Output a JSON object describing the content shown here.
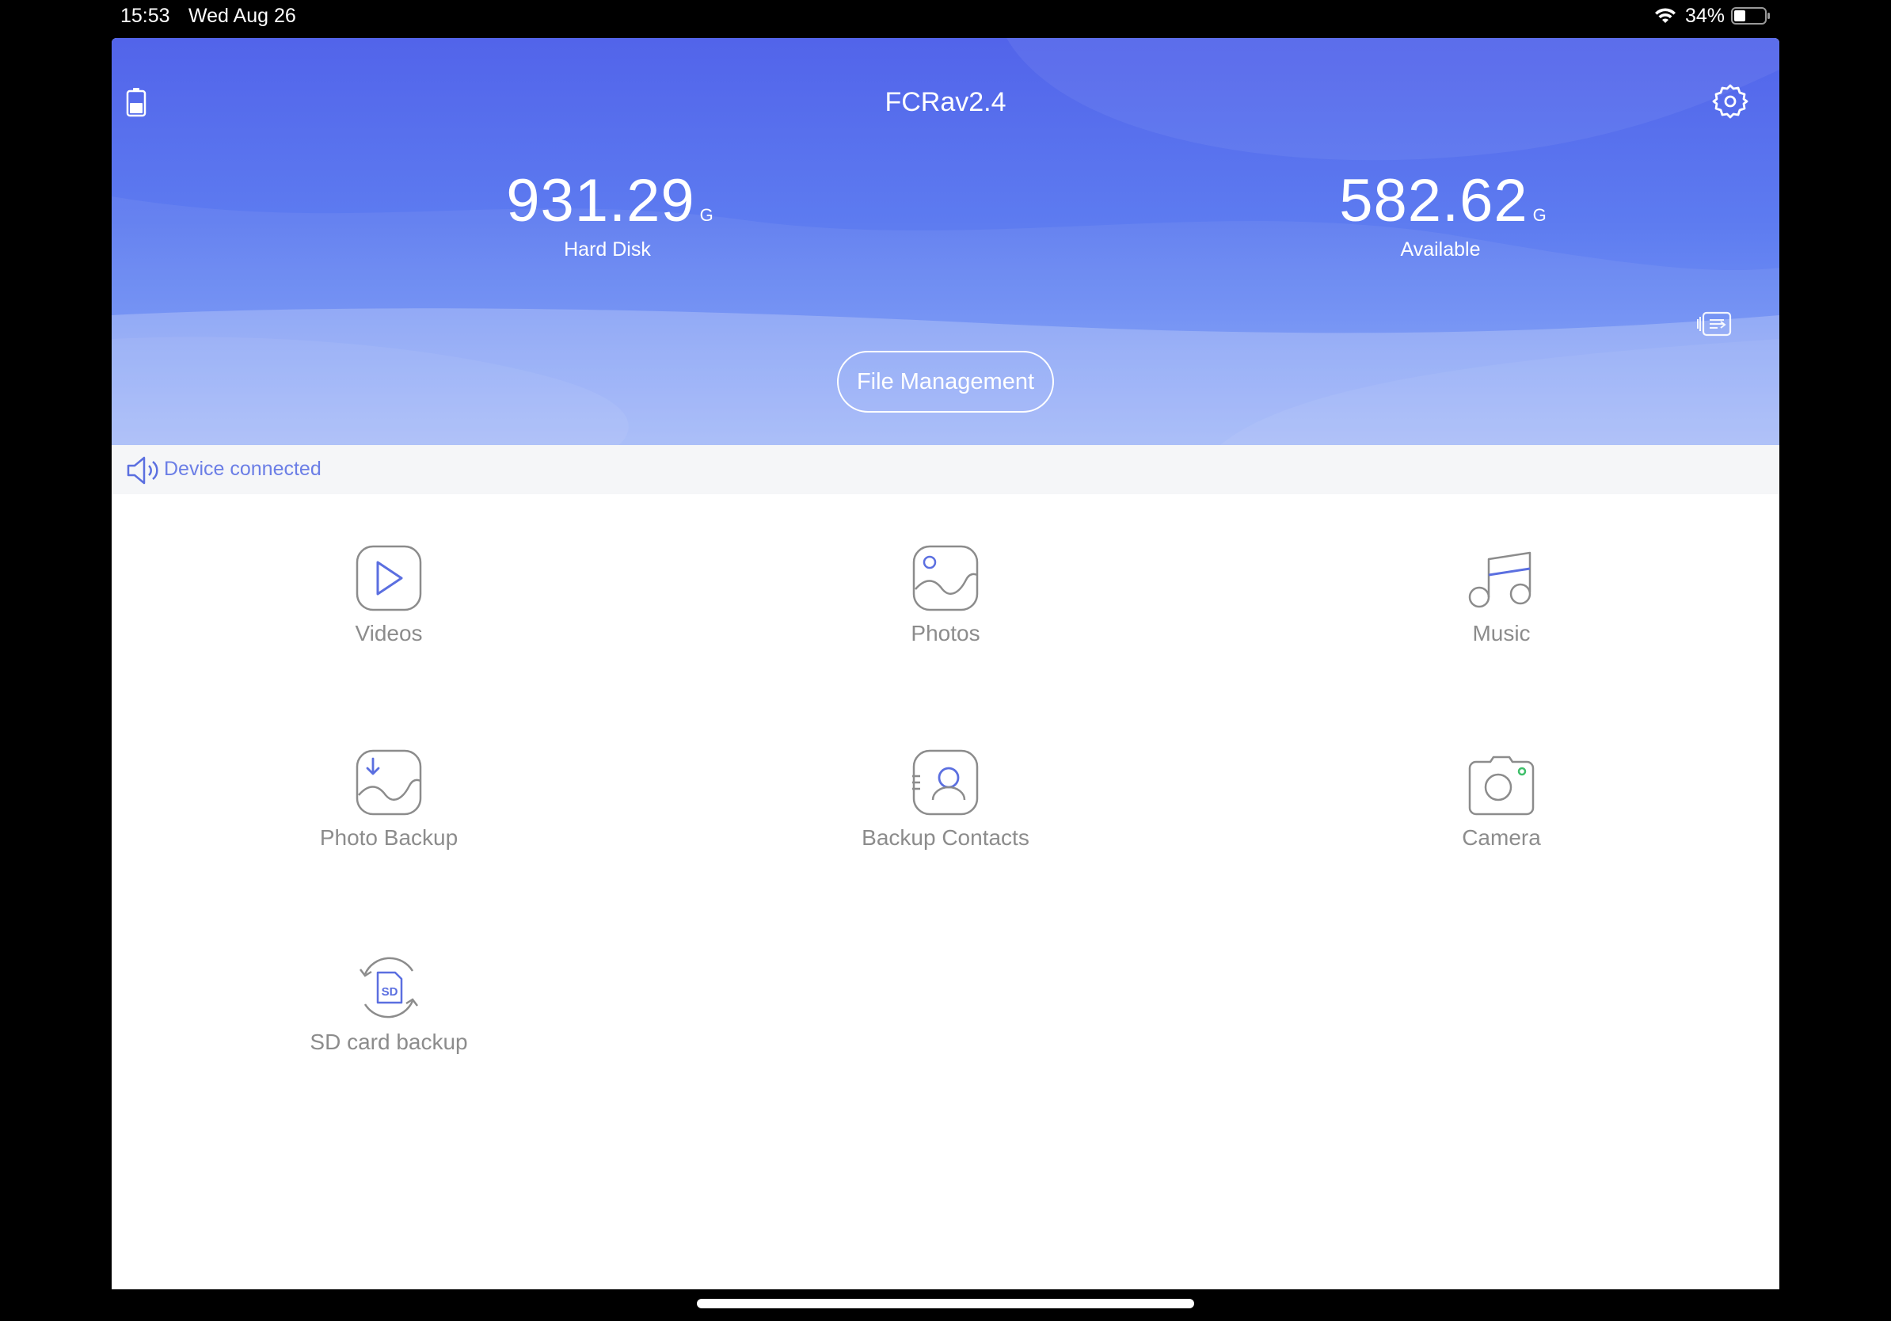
{
  "status_bar": {
    "time": "15:53",
    "date": "Wed Aug 26",
    "battery_percent": "34%",
    "icons": [
      "wifi-icon",
      "battery-icon"
    ]
  },
  "header": {
    "title": "FCRav2.4",
    "hard_disk": {
      "value": "931.29",
      "unit": "G",
      "label": "Hard Disk"
    },
    "available": {
      "value": "582.62",
      "unit": "G",
      "label": "Available"
    },
    "file_management_label": "File Management",
    "icons": [
      "device-battery-icon",
      "settings-gear-icon",
      "switch-device-icon"
    ]
  },
  "notice": {
    "text": "Device connected",
    "icon": "speaker-icon"
  },
  "grid": {
    "videos": "Videos",
    "photos": "Photos",
    "music": "Music",
    "photo_backup": "Photo Backup",
    "backup_contacts": "Backup Contacts",
    "camera": "Camera",
    "sd_card_backup": "SD card backup",
    "sd_badge": "SD"
  },
  "colors": {
    "header_top": "#5264ea",
    "header_bottom": "#8ea8f7",
    "accent": "#5b6fe0",
    "icon_gray": "#8c8c8c",
    "camera_dot": "#3fbf6a"
  }
}
